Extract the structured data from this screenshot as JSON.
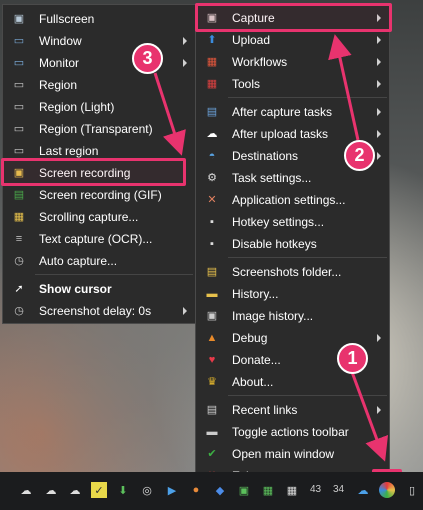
{
  "left_menu": {
    "items": [
      {
        "label": "Fullscreen",
        "icon": "fullscreen-icon",
        "glyph": "▣",
        "color": "#b7c9d8",
        "submenu": false
      },
      {
        "label": "Window",
        "icon": "window-icon",
        "glyph": "▭",
        "color": "#7aa9d6",
        "submenu": true
      },
      {
        "label": "Monitor",
        "icon": "monitor-icon",
        "glyph": "▭",
        "color": "#7fb2e3",
        "submenu": true
      },
      {
        "label": "Region",
        "icon": "region-icon",
        "glyph": "▭",
        "color": "#c9c9c9",
        "submenu": false
      },
      {
        "label": "Region (Light)",
        "icon": "region-light-icon",
        "glyph": "▭",
        "color": "#c9c9c9",
        "submenu": false
      },
      {
        "label": "Region (Transparent)",
        "icon": "region-transparent-icon",
        "glyph": "▭",
        "color": "#c9c9c9",
        "submenu": false
      },
      {
        "label": "Last region",
        "icon": "last-region-icon",
        "glyph": "▭",
        "color": "#c9c9c9",
        "submenu": false
      },
      {
        "label": "Screen recording",
        "icon": "screen-recording-icon",
        "glyph": "▣",
        "color": "#e7c14c",
        "submenu": false
      },
      {
        "label": "Screen recording (GIF)",
        "icon": "gif-recording-icon",
        "glyph": "▤",
        "color": "#4aa84a",
        "submenu": false
      },
      {
        "label": "Scrolling capture...",
        "icon": "scrolling-capture-icon",
        "glyph": "▦",
        "color": "#e7c14c",
        "submenu": false
      },
      {
        "label": "Text capture (OCR)...",
        "icon": "ocr-icon",
        "glyph": "≡",
        "color": "#bbbbbb",
        "submenu": false
      },
      {
        "label": "Auto capture...",
        "icon": "clock-icon",
        "glyph": "◷",
        "color": "#cccccc",
        "submenu": false
      },
      {
        "label": "Show cursor",
        "icon": "cursor-icon",
        "glyph": "➚",
        "color": "#ffffff",
        "submenu": false,
        "bold": true
      },
      {
        "label": "Screenshot delay: 0s",
        "icon": "delay-clock-icon",
        "glyph": "◷",
        "color": "#cccccc",
        "submenu": true
      }
    ]
  },
  "right_menu": {
    "items": [
      {
        "label": "Capture",
        "icon": "capture-icon",
        "glyph": "▣",
        "color": "#d9c9c9",
        "submenu": true
      },
      {
        "label": "Upload",
        "icon": "upload-arrow-icon",
        "glyph": "⬆",
        "color": "#3b8bdc",
        "submenu": true
      },
      {
        "label": "Workflows",
        "icon": "workflows-grid-icon",
        "glyph": "▦",
        "color": "#e0563c",
        "submenu": true
      },
      {
        "label": "Tools",
        "icon": "tools-icon",
        "glyph": "▦",
        "color": "#d94040",
        "submenu": true
      },
      {
        "label": "After capture tasks",
        "icon": "after-capture-icon",
        "glyph": "▤",
        "color": "#6aa0d8",
        "submenu": true
      },
      {
        "label": "After upload tasks",
        "icon": "after-upload-icon",
        "glyph": "☁",
        "color": "#ffffff",
        "submenu": true
      },
      {
        "label": "Destinations",
        "icon": "destinations-icon",
        "glyph": "◓",
        "color": "#58a1e0",
        "submenu": true
      },
      {
        "label": "Task settings...",
        "icon": "gear-icon",
        "glyph": "⚙",
        "color": "#dddddd",
        "submenu": false
      },
      {
        "label": "Application settings...",
        "icon": "wrench-icon",
        "glyph": "✕",
        "color": "#e08060",
        "submenu": false
      },
      {
        "label": "Hotkey settings...",
        "icon": "keyboard-icon",
        "glyph": "▪",
        "color": "#dddddd",
        "submenu": false
      },
      {
        "label": "Disable hotkeys",
        "icon": "disable-hotkeys-icon",
        "glyph": "▪",
        "color": "#dddddd",
        "submenu": false
      },
      {
        "label": "Screenshots folder...",
        "icon": "folder-icon",
        "glyph": "▤",
        "color": "#e7c14c",
        "submenu": false
      },
      {
        "label": "History...",
        "icon": "history-icon",
        "glyph": "▬",
        "color": "#e7c14c",
        "submenu": false
      },
      {
        "label": "Image history...",
        "icon": "image-history-icon",
        "glyph": "▣",
        "color": "#cccccc",
        "submenu": false
      },
      {
        "label": "Debug",
        "icon": "debug-cone-icon",
        "glyph": "▲",
        "color": "#e88a2a",
        "submenu": true
      },
      {
        "label": "Donate...",
        "icon": "heart-icon",
        "glyph": "♥",
        "color": "#e83a4a",
        "submenu": false
      },
      {
        "label": "About...",
        "icon": "crown-icon",
        "glyph": "♛",
        "color": "#e7b92c",
        "submenu": false
      },
      {
        "label": "Recent links",
        "icon": "recent-links-icon",
        "glyph": "▤",
        "color": "#cccccc",
        "submenu": true
      },
      {
        "label": "Toggle actions toolbar",
        "icon": "toolbar-icon",
        "glyph": "▬",
        "color": "#cccccc",
        "submenu": false
      },
      {
        "label": "Open main window",
        "icon": "checkmark-icon",
        "glyph": "✔",
        "color": "#3cb043",
        "submenu": false
      },
      {
        "label": "Exit",
        "icon": "exit-x-icon",
        "glyph": "✖",
        "color": "#e03a3a",
        "submenu": false
      }
    ]
  },
  "badges": {
    "one": "1",
    "two": "2",
    "three": "3"
  },
  "taskbar": {
    "numbers": [
      "43",
      "34"
    ],
    "icons": [
      "cloud-upload-icon",
      "cloud-upload-icon-2",
      "cloud-upload-icon-3",
      "sticky-notes-icon",
      "download-icon",
      "steam-icon",
      "remote-desktop-icon",
      "microphone-icon",
      "shield-icon",
      "greenshot-icon",
      "calendar-icon",
      "sharex-icon",
      "usb-icon"
    ]
  },
  "colors": {
    "highlight": "#e8336e",
    "menu_bg": "#2b2b2b"
  }
}
